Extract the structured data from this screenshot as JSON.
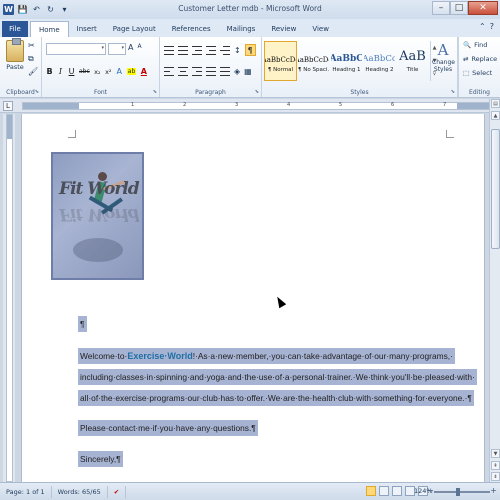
{
  "window": {
    "title": "Customer Letter mdb - Microsoft Word",
    "app_icon": "W",
    "controls": [
      "–",
      "□",
      "✕"
    ]
  },
  "quick_access": {
    "save_icon": "💾",
    "undo_icon": "↶",
    "redo_icon": "↻",
    "customize_icon": "▾"
  },
  "tabs": [
    "File",
    "Home",
    "Insert",
    "Page Layout",
    "References",
    "Mailings",
    "Review",
    "View"
  ],
  "active_tab": "Home",
  "ribbon": {
    "clipboard": {
      "label": "Clipboard",
      "paste_label": "Paste",
      "cut_icon": "✂",
      "copy_icon": "⧉",
      "format_painter_icon": "🖌"
    },
    "font": {
      "label": "Font",
      "font_name": "",
      "font_size": "",
      "grow": "A",
      "shrink": "A",
      "case": "Aa",
      "clear": "⌀",
      "bold": "B",
      "italic": "I",
      "underline": "U",
      "strike": "abc",
      "subscript": "x₂",
      "superscript": "x²",
      "effects": "A",
      "highlight": "ab",
      "color": "A"
    },
    "paragraph": {
      "label": "Paragraph",
      "pilcrow": "¶",
      "sort": "↕",
      "shading": "◈",
      "borders": "▦"
    },
    "styles": {
      "label": "Styles",
      "items": [
        {
          "sample": "AaBbCcDc",
          "name": "¶ Normal"
        },
        {
          "sample": "AaBbCcDc",
          "name": "¶ No Spaci..."
        },
        {
          "sample": "AaBbC",
          "name": "Heading 1"
        },
        {
          "sample": "AaBbCc",
          "name": "Heading 2"
        },
        {
          "sample": "AaB",
          "name": "Title"
        }
      ],
      "change_styles": "Change Styles",
      "change_icon": "A"
    },
    "editing": {
      "label": "Editing",
      "find": "Find",
      "replace": "Replace",
      "select": "Select"
    }
  },
  "ruler": {
    "numbers": [
      "1",
      "2",
      "3",
      "4",
      "5",
      "6",
      "7"
    ],
    "tab_selector": "L"
  },
  "document": {
    "logo_text": "Fit World",
    "pilcrow": "¶",
    "lines": [
      {
        "pre": "Welcome·to·",
        "brand": "Exercise·World",
        "post": "!·As·a·new·member,·you·can·take·advantage·of·our·many·programs,·"
      },
      {
        "text": "including·classes·in·spinning·and·yoga·and·the·use·of·a·personal·trainer.·We·think·you'll·be·pleased·with·"
      },
      {
        "text": "all·of·the·exercise·programs·our·club·has·to·offer.·We·are·the·health·club·with·something·for·everyone.·¶"
      },
      {
        "text": "Please·contact·me·if·you·have·any·questions.¶"
      },
      {
        "text": "Sincerely,¶"
      }
    ]
  },
  "status": {
    "page": "Page: 1 of 1",
    "words": "Words: 65/65",
    "proof_icon": "✔",
    "zoom": "124%"
  }
}
